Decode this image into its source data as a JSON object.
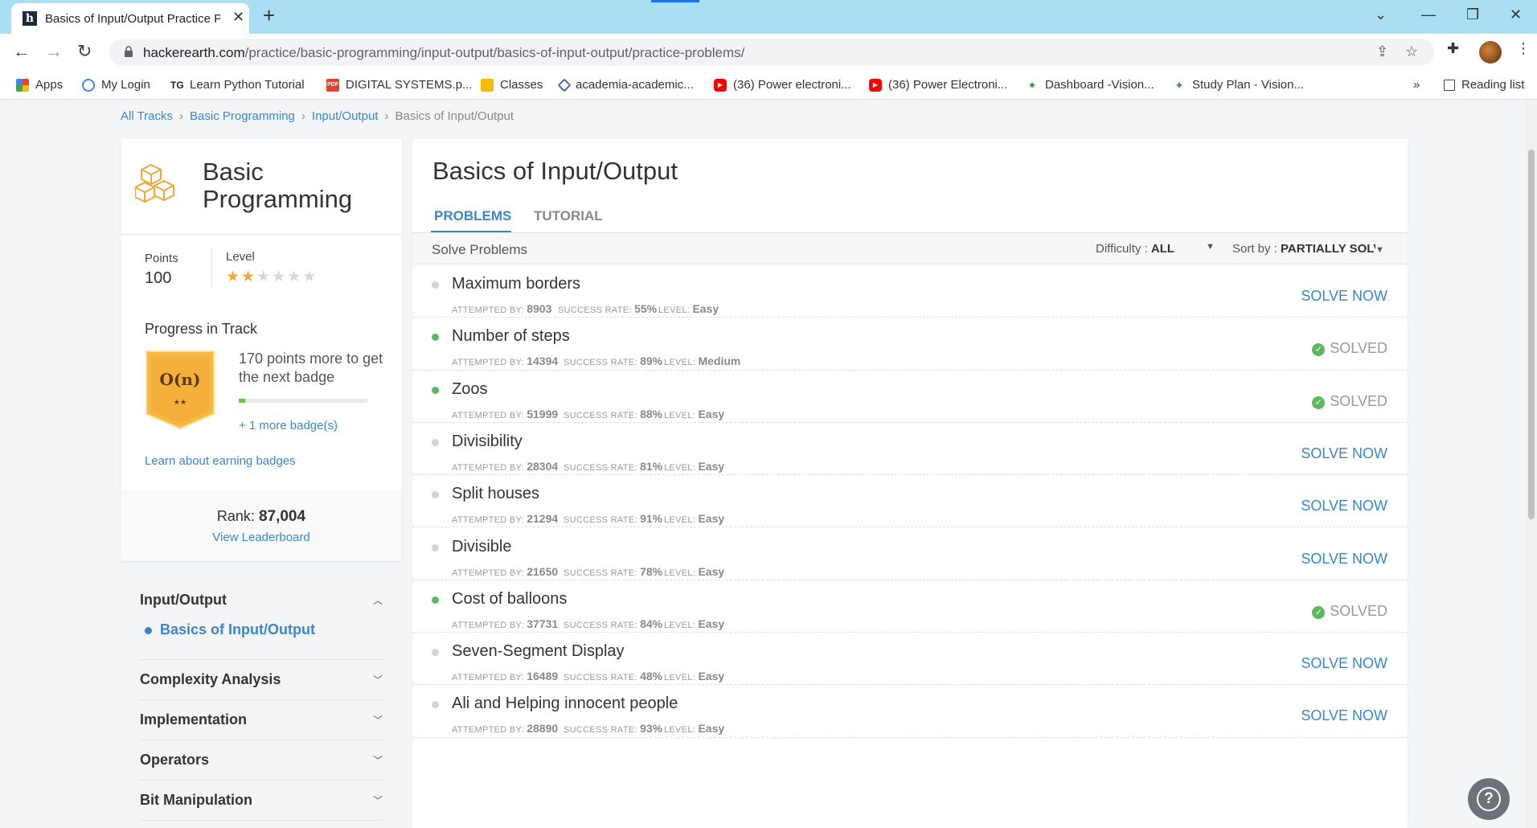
{
  "browser": {
    "tab_title": "Basics of Input/Output Practice P",
    "tab_favicon": "h",
    "url_host": "hackerearth.com",
    "url_path": "/practice/basic-programming/input-output/basics-of-input-output/practice-problems/",
    "bookmarks": [
      {
        "label": "Apps",
        "icon": "apps-grid-icon"
      },
      {
        "label": "My Login",
        "icon": "login-icon"
      },
      {
        "label": "Learn Python Tutorial",
        "icon": "tg-icon"
      },
      {
        "label": "DIGITAL SYSTEMS.p...",
        "icon": "pdf-icon"
      },
      {
        "label": "Classes",
        "icon": "classroom-icon"
      },
      {
        "label": "academia-academic...",
        "icon": "academia-icon"
      },
      {
        "label": "(36) Power electroni...",
        "icon": "youtube-icon"
      },
      {
        "label": "(36) Power Electroni...",
        "icon": "youtube-icon"
      },
      {
        "label": "Dashboard -Vision...",
        "icon": "vision-icon"
      },
      {
        "label": "Study Plan - Vision...",
        "icon": "vision-icon"
      }
    ],
    "bookmarks_more": "»",
    "reading_list": "Reading list"
  },
  "breadcrumb": {
    "items": [
      "All Tracks",
      "Basic Programming",
      "Input/Output"
    ],
    "current": "Basics of Input/Output"
  },
  "track": {
    "name_line1": "Basic",
    "name_line2": "Programming",
    "points_label": "Points",
    "points_value": "100",
    "level_label": "Level",
    "level_stars_filled": 2,
    "level_stars_total": 6,
    "progress_title": "Progress in Track",
    "badge_label": "O(n)",
    "badge_stars": "★★",
    "progress_text": "170 points more to get the next badge",
    "progress_fraction": 0.05,
    "more_badges": "+ 1 more badge(s)",
    "learn_link": "Learn about earning badges",
    "rank_label": "Rank:",
    "rank_value": "87,004",
    "leaderboard_link": "View Leaderboard"
  },
  "topics": {
    "expanded": "Input/Output",
    "active_subtopic": "Basics of Input/Output",
    "collapsed": [
      "Complexity Analysis",
      "Implementation",
      "Operators",
      "Bit Manipulation"
    ]
  },
  "main": {
    "title": "Basics of Input/Output",
    "tabs": [
      "PROBLEMS",
      "TUTORIAL"
    ],
    "solve_label": "Solve Problems",
    "difficulty_label": "Difficulty :",
    "difficulty_value": "ALL",
    "sort_label": "Sort by :",
    "sort_value": "PARTIALLY SOLVED",
    "meta_labels": {
      "attempted": "ATTEMPTED BY:",
      "success": "SUCCESS RATE:",
      "level": "LEVEL:"
    },
    "solve_now_label": "SOLVE NOW",
    "solved_label": "SOLVED",
    "problems": [
      {
        "name": "Maximum borders",
        "attempted": "8903",
        "success": "55%",
        "level": "Easy",
        "solved": false
      },
      {
        "name": "Number of steps",
        "attempted": "14394",
        "success": "89%",
        "level": "Medium",
        "solved": true
      },
      {
        "name": "Zoos",
        "attempted": "51999",
        "success": "88%",
        "level": "Easy",
        "solved": true
      },
      {
        "name": "Divisibility",
        "attempted": "28304",
        "success": "81%",
        "level": "Easy",
        "solved": false
      },
      {
        "name": "Split houses",
        "attempted": "21294",
        "success": "91%",
        "level": "Easy",
        "solved": false
      },
      {
        "name": "Divisible",
        "attempted": "21650",
        "success": "78%",
        "level": "Easy",
        "solved": false
      },
      {
        "name": "Cost of balloons",
        "attempted": "37731",
        "success": "84%",
        "level": "Easy",
        "solved": true
      },
      {
        "name": "Seven-Segment Display",
        "attempted": "16489",
        "success": "48%",
        "level": "Easy",
        "solved": false
      },
      {
        "name": "Ali and Helping innocent people",
        "attempted": "28890",
        "success": "93%",
        "level": "Easy",
        "solved": false
      }
    ]
  },
  "help_icon": "?"
}
